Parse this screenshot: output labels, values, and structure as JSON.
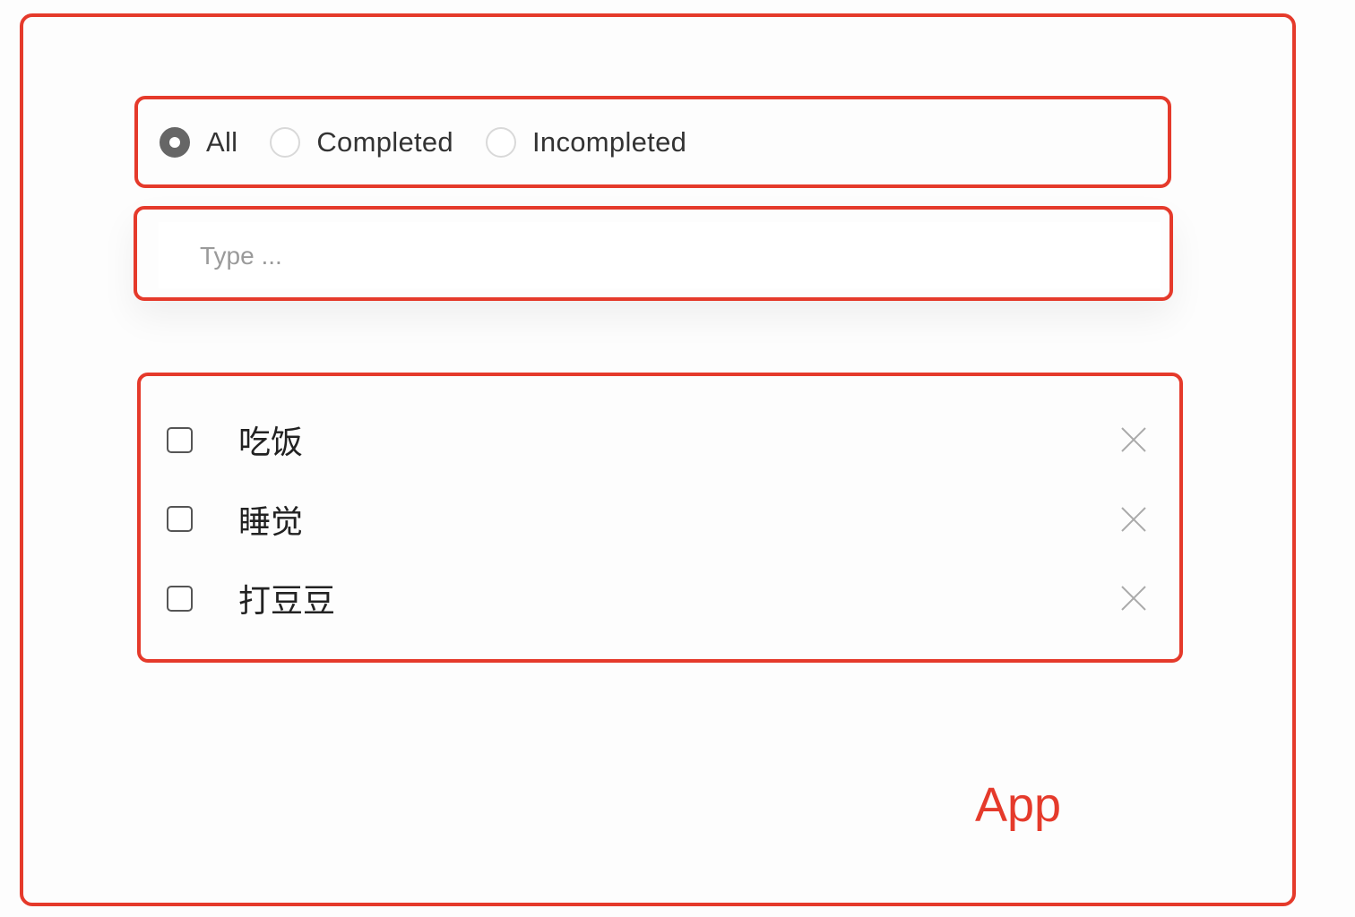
{
  "app": {
    "label": "App"
  },
  "filter": {
    "options": [
      {
        "label": "All",
        "checked": true
      },
      {
        "label": "Completed",
        "checked": false
      },
      {
        "label": "Incompleted",
        "checked": false
      }
    ]
  },
  "input": {
    "placeholder": "Type ...",
    "value": ""
  },
  "todos": [
    {
      "text": "吃饭",
      "completed": false
    },
    {
      "text": "睡觉",
      "completed": false
    },
    {
      "text": "打豆豆",
      "completed": false
    }
  ],
  "colors": {
    "annotation": "#e53a2b",
    "radio_checked": "#666666"
  },
  "icons": {
    "delete": "close-icon"
  }
}
